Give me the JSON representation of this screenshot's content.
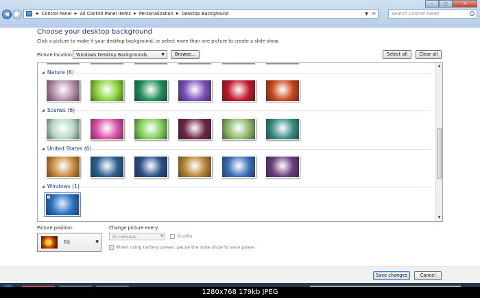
{
  "window": {
    "minimize": "–",
    "maximize": "□",
    "close": "✕"
  },
  "breadcrumb": [
    "Control Panel",
    "All Control Panel Items",
    "Personalization",
    "Desktop Background"
  ],
  "search": {
    "placeholder": "Search Control Panel"
  },
  "main": {
    "title": "Choose your desktop background",
    "subtitle": "Click a picture to make it your desktop background, or select more than one picture to create a slide show.",
    "location_label": "Picture location:",
    "location_value": "Windows Desktop Backgrounds",
    "browse": "Browse...",
    "select_all": "Select all",
    "clear_all": "Clear all"
  },
  "groups": [
    {
      "label": "Nature (6)"
    },
    {
      "label": "Scenes (6)"
    },
    {
      "label": "United States (6)"
    },
    {
      "label": "Windows (1)"
    }
  ],
  "colors": {
    "nature": [
      "#b48aa8",
      "#8bd23a",
      "#1f8f5c",
      "#7a4fb8",
      "#c2182c",
      "#c8481d"
    ],
    "scenes": [
      "#b6d8c6",
      "#d94fa6",
      "#7fcf5a",
      "#6e2448",
      "#8fb86a",
      "#3a8c84"
    ],
    "us": [
      "#c98a3a",
      "#2c5f8e",
      "#2a4f8a",
      "#b78432",
      "#3b6fb7",
      "#6a3c7e"
    ],
    "windows": "#2a71c4"
  },
  "bottom": {
    "position_label": "Picture position:",
    "position_value": "Fill",
    "change_label": "Change picture every:",
    "interval": "30 minutes",
    "shuffle": "Shuffle",
    "battery": "When using battery power, pause the slide show to save power"
  },
  "footer": {
    "save": "Save changes",
    "cancel": "Cancel"
  },
  "image_info": "1280x768 179kb JPEG"
}
